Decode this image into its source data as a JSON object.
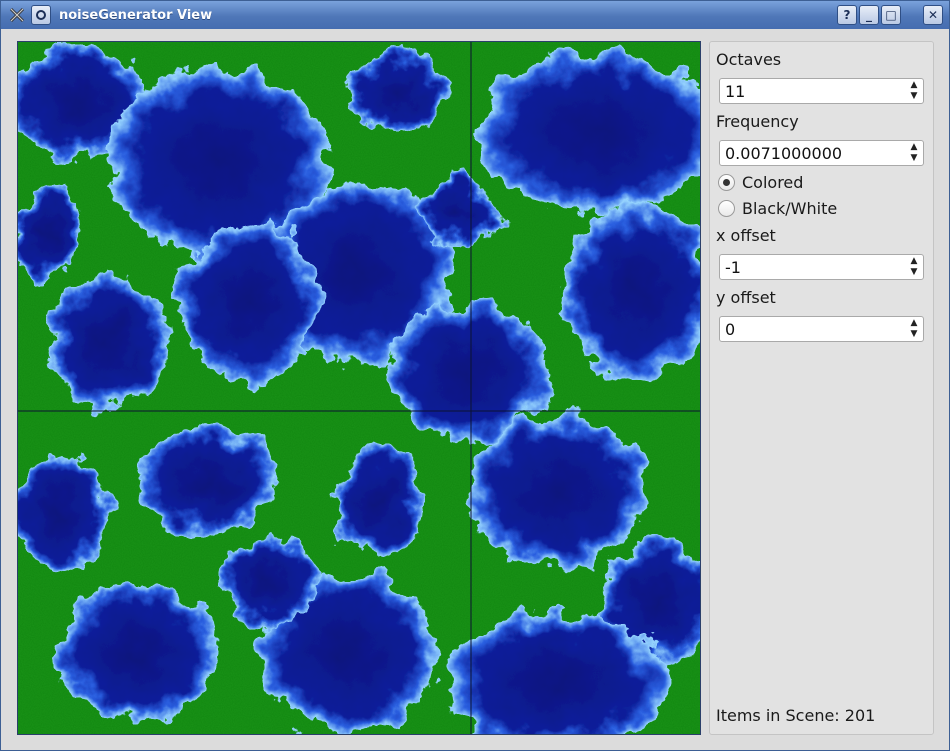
{
  "window": {
    "title": "noiseGenerator View",
    "help_label": "?",
    "minimize_label": "_",
    "maximize_label": "□",
    "close_label": "✕"
  },
  "panel": {
    "octaves_label": "Octaves",
    "octaves_value": "11",
    "frequency_label": "Frequency",
    "frequency_value": "0.0071000000",
    "mode_colored": "Colored",
    "mode_bw": "Black/White",
    "mode_selected": "Colored",
    "x_offset_label": "x offset",
    "x_offset_value": "-1",
    "y_offset_label": "y offset",
    "y_offset_value": "0",
    "status": "Items in Scene: 201"
  },
  "colors": {
    "deep": "#0a1790",
    "water": "#1838c8",
    "shore": "#8fd0ff",
    "land": "#1f9f1a",
    "land_dark": "#106812"
  }
}
